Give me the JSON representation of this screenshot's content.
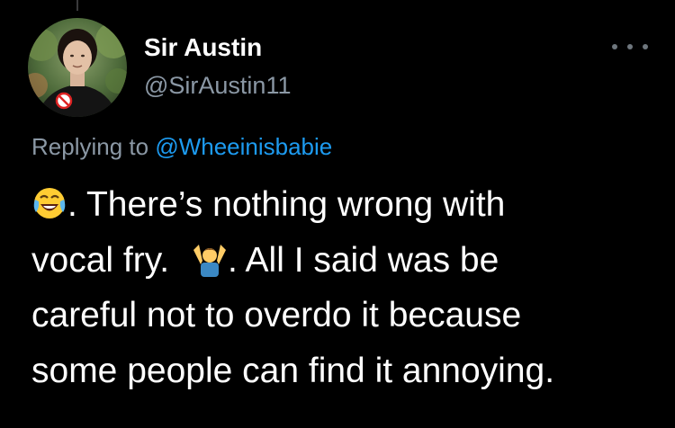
{
  "author": {
    "display_name": "Sir Austin",
    "handle": "@SirAustin11"
  },
  "reply_context": {
    "prefix": "Replying to",
    "mention": "@Wheeinisbabie"
  },
  "tweet": {
    "line1": {
      "emoji": "laughing-crying-face-icon",
      "text": ".  There’s nothing wrong with"
    },
    "line2": {
      "text_before": "vocal fry.",
      "emoji": "person-shrugging-icon",
      "text_after": ".  All I said was be"
    },
    "line3": "careful not to overdo it because",
    "line4": "some people can find it annoying."
  },
  "colors": {
    "background": "#000000",
    "name": "#ffffff",
    "secondary": "#8b98a5",
    "link": "#1d9bf0"
  }
}
